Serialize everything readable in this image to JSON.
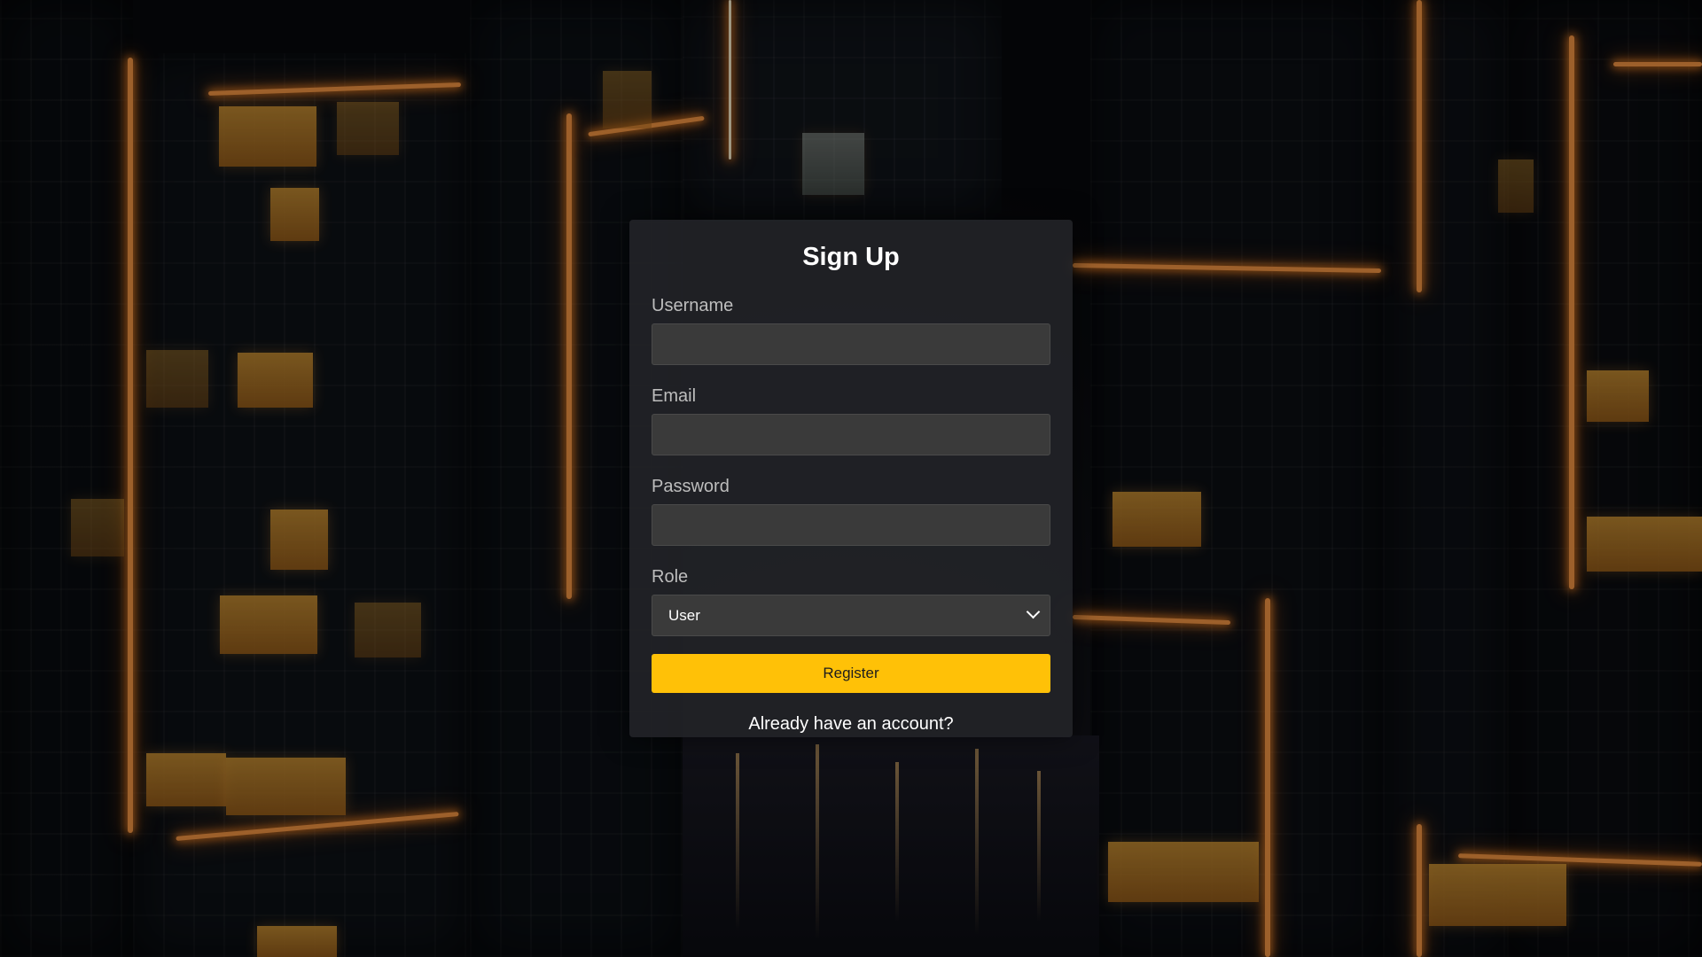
{
  "form": {
    "title": "Sign Up",
    "username_label": "Username",
    "username_value": "",
    "email_label": "Email",
    "email_value": "",
    "password_label": "Password",
    "password_value": "",
    "role_label": "Role",
    "role_selected": "User",
    "register_label": "Register",
    "login_link": "Already have an account?"
  },
  "colors": {
    "accent": "#ffc107",
    "card_bg": "#222428",
    "input_bg": "#3a3a3a",
    "glow": "#f19442"
  },
  "icons": {
    "role_dropdown": "chevron-down-icon"
  }
}
